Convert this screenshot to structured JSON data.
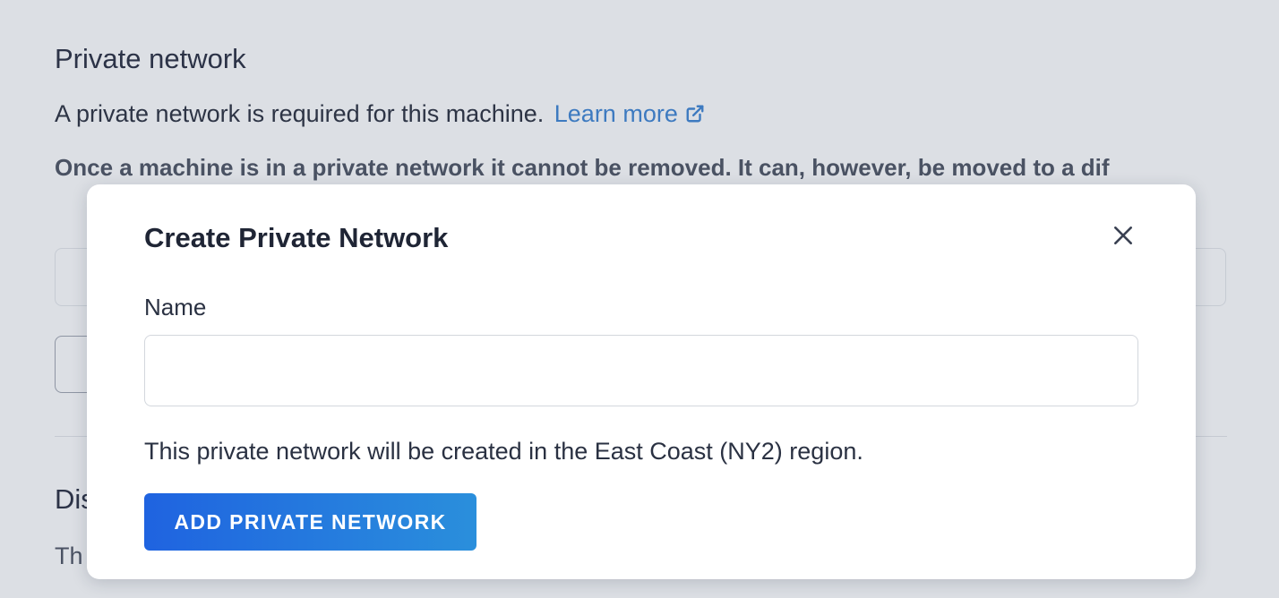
{
  "background": {
    "section_title": "Private network",
    "description": "A private network is required for this machine.",
    "learn_more_label": "Learn more",
    "warning": "Once a machine is in a private network it cannot be removed. It can, however, be moved to a dif",
    "next_section_title": "Dis",
    "next_section_text": "Th"
  },
  "modal": {
    "title": "Create Private Network",
    "close_icon": "close-icon",
    "name_label": "Name",
    "name_value": "",
    "name_placeholder": "",
    "region_notice": "This private network will be created in the East Coast (NY2) region.",
    "submit_label": "ADD PRIVATE NETWORK"
  },
  "colors": {
    "link": "#3d7ac0",
    "button_gradient_start": "#1f63e0",
    "button_gradient_end": "#2a8fdc",
    "backdrop": "#dcdfe4"
  }
}
